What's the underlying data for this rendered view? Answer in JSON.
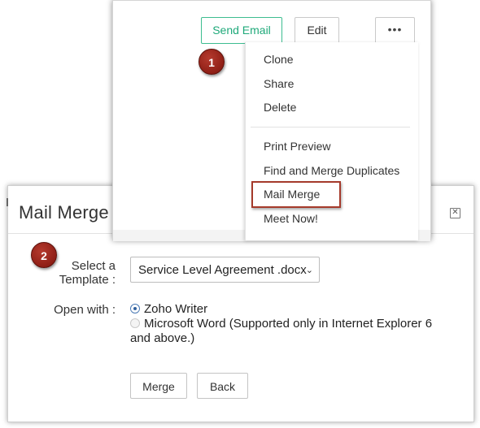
{
  "toolbar": {
    "send_email_label": "Send Email",
    "edit_label": "Edit",
    "more_label": "•••"
  },
  "menu": {
    "items": [
      "Clone",
      "Share",
      "Delete",
      "Print Preview",
      "Find and Merge Duplicates",
      "Mail Merge",
      "Meet Now!"
    ]
  },
  "badges": {
    "step1": "1",
    "step2": "2"
  },
  "dialog": {
    "title": "Mail Merge",
    "close_icon": "close-icon",
    "template_label_line1": "Select a",
    "template_label_line2": "Template :",
    "template_value": "Service Level Agreement .docx",
    "open_with_label": "Open with :",
    "options": [
      "Zoho Writer",
      "Microsoft Word (Supported only in Internet Explorer 6",
      "and above.)"
    ],
    "selected_option": "Zoho Writer",
    "merge_label": "Merge",
    "back_label": "Back"
  },
  "colors": {
    "send_email_accent": "#1fa97a",
    "badge": "#8f1f16",
    "highlight_border": "#a53a2b",
    "radio_selected": "#2f5f9d"
  }
}
